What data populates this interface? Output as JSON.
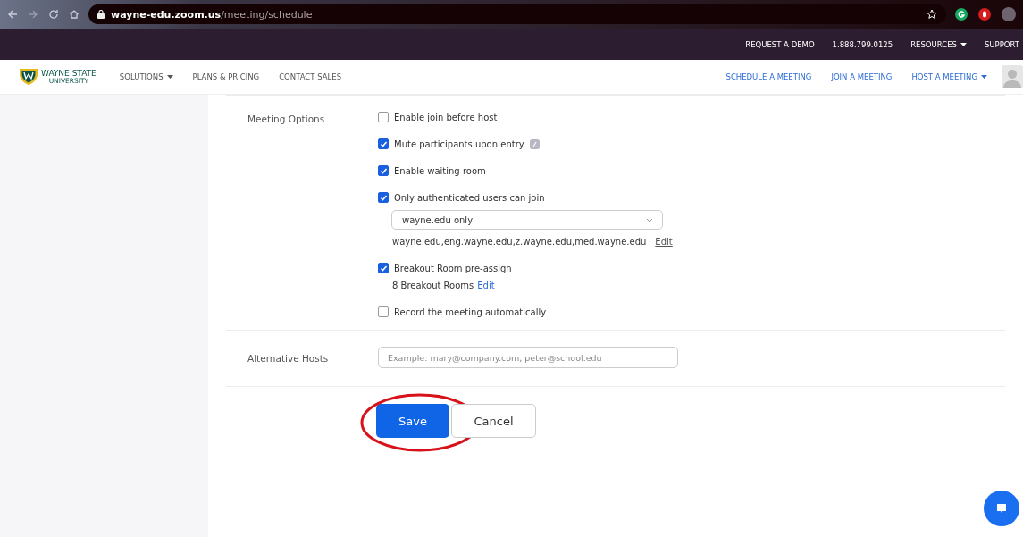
{
  "browser": {
    "url_host": "wayne-edu.zoom.us",
    "url_path": "/meeting/schedule"
  },
  "top_bar": {
    "links": [
      {
        "label": "REQUEST A DEMO",
        "dropdown": false
      },
      {
        "label": "1.888.799.0125",
        "dropdown": false
      },
      {
        "label": "RESOURCES",
        "dropdown": true
      },
      {
        "label": "SUPPORT",
        "dropdown": false
      }
    ]
  },
  "nav": {
    "logo": {
      "line1": "WAYNE STATE",
      "line2": "UNIVERSITY"
    },
    "left_links": [
      {
        "label": "SOLUTIONS",
        "dropdown": true
      },
      {
        "label": "PLANS & PRICING",
        "dropdown": false
      },
      {
        "label": "CONTACT SALES",
        "dropdown": false
      }
    ],
    "right_links": [
      {
        "label": "SCHEDULE A MEETING",
        "dropdown": false
      },
      {
        "label": "JOIN A MEETING",
        "dropdown": false
      },
      {
        "label": "HOST A MEETING",
        "dropdown": true
      }
    ]
  },
  "meeting_options": {
    "label": "Meeting Options",
    "options": [
      {
        "kind": "checkbox",
        "label": "Enable join before host",
        "checked": false
      },
      {
        "kind": "checkbox_info",
        "label": "Mute participants upon entry",
        "checked": true
      },
      {
        "kind": "checkbox",
        "label": "Enable waiting room",
        "checked": true
      },
      {
        "kind": "checkbox",
        "label": "Only authenticated users can join",
        "checked": true,
        "select": {
          "value": "wayne.edu only"
        },
        "note": {
          "text": "wayne.edu,eng.wayne.edu,z.wayne.edu,med.wayne.edu",
          "link": "Edit",
          "underlined": true
        }
      },
      {
        "kind": "checkbox",
        "label": "Breakout Room pre-assign",
        "checked": true,
        "note": {
          "text": "8 Breakout Rooms",
          "link": "Edit",
          "underlined": false
        }
      },
      {
        "kind": "checkbox",
        "label": "Record the meeting automatically",
        "checked": false
      }
    ]
  },
  "alternative_hosts": {
    "label": "Alternative Hosts",
    "placeholder": "Example: mary@company.com, peter@school.edu"
  },
  "buttons": [
    {
      "label": "Save",
      "kind": "primary",
      "highlighted": true
    },
    {
      "label": "Cancel",
      "kind": "secondary",
      "highlighted": false
    }
  ]
}
